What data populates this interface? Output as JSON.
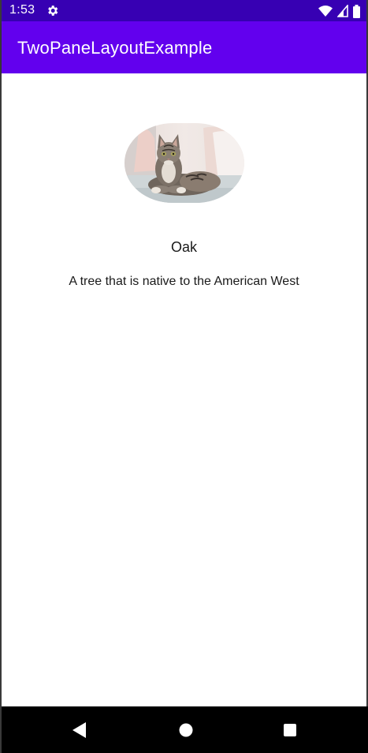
{
  "status_bar": {
    "time": "1:53",
    "icons": [
      "settings-icon",
      "wifi-icon",
      "cell-signal-icon",
      "battery-icon"
    ],
    "color": "#3700b3"
  },
  "app_bar": {
    "title": "TwoPaneLayoutExample",
    "color": "#6200ee"
  },
  "detail": {
    "image": "cat-photo",
    "name": "Oak",
    "description": "A tree that is native to the American West"
  },
  "nav_bar": {
    "buttons": [
      "back-icon",
      "home-icon",
      "recents-icon"
    ],
    "color": "#000000"
  }
}
